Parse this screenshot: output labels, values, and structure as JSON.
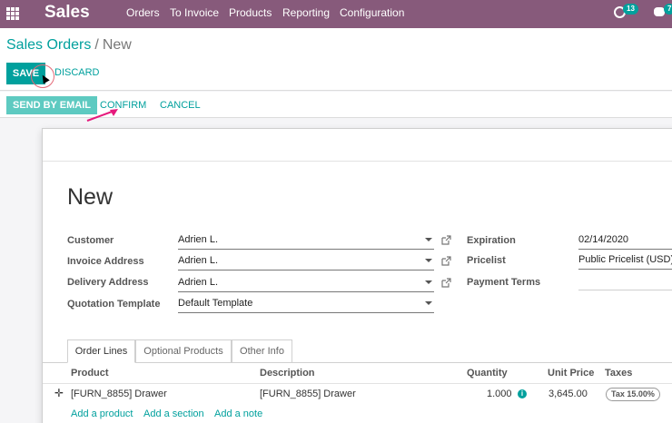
{
  "navbar": {
    "brand": "Sales",
    "menu": [
      "Orders",
      "To Invoice",
      "Products",
      "Reporting",
      "Configuration"
    ],
    "activity_count": "13",
    "messages_count": "7"
  },
  "breadcrumb": {
    "parent": "Sales Orders",
    "current": "New"
  },
  "actions": {
    "save": "SAVE",
    "discard": "DISCARD"
  },
  "statusbar": {
    "send_email": "SEND BY EMAIL",
    "confirm": "CONFIRM",
    "cancel": "CANCEL"
  },
  "form": {
    "title": "New",
    "left_fields": [
      {
        "label": "Customer",
        "value": "Adrien L."
      },
      {
        "label": "Invoice Address",
        "value": "Adrien L."
      },
      {
        "label": "Delivery Address",
        "value": "Adrien L."
      },
      {
        "label": "Quotation Template",
        "value": "Default Template"
      }
    ],
    "right_fields": [
      {
        "label": "Expiration",
        "value": "02/14/2020"
      },
      {
        "label": "Pricelist",
        "value": "Public Pricelist (USD)"
      },
      {
        "label": "Payment Terms",
        "value": ""
      }
    ],
    "tabs": [
      "Order Lines",
      "Optional Products",
      "Other Info"
    ],
    "table": {
      "headers": [
        "Product",
        "Description",
        "Quantity",
        "Unit Price",
        "Taxes"
      ],
      "rows": [
        {
          "product": "[FURN_8855] Drawer",
          "description": "[FURN_8855] Drawer",
          "quantity": "1.000",
          "unit_price": "3,645.00",
          "tax": "Tax 15.00%"
        }
      ]
    },
    "add_links": [
      "Add a product",
      "Add a section",
      "Add a note"
    ]
  },
  "colors": {
    "navbar": "#875a7b",
    "primary": "#00a09d",
    "email_btn": "#5ecac1"
  }
}
